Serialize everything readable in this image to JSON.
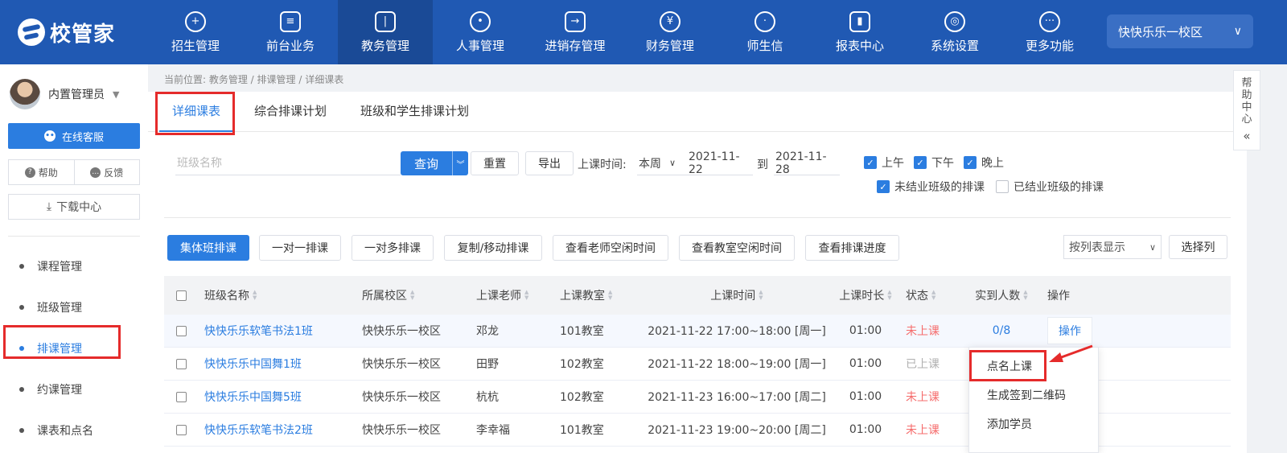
{
  "app": {
    "logo_text": "校管家"
  },
  "nav": {
    "items": [
      {
        "label": "招生管理",
        "icon": "person-add-icon"
      },
      {
        "label": "前台业务",
        "icon": "monitor-icon"
      },
      {
        "label": "教务管理",
        "icon": "book-icon"
      },
      {
        "label": "人事管理",
        "icon": "person-icon"
      },
      {
        "label": "进销存管理",
        "icon": "login-box-icon"
      },
      {
        "label": "财务管理",
        "icon": "money-bag-icon"
      },
      {
        "label": "师生信",
        "icon": "chat-icon"
      },
      {
        "label": "报表中心",
        "icon": "bar-chart-icon"
      },
      {
        "label": "系统设置",
        "icon": "settings-icon"
      },
      {
        "label": "更多功能",
        "icon": "more-icon"
      }
    ],
    "active_index": 2,
    "campus": "快快乐乐一校区"
  },
  "sidebar": {
    "user_name": "内置管理员",
    "service_label": "在线客服",
    "help_label": "帮助",
    "feedback_label": "反馈",
    "download_label": "下载中心",
    "menu": [
      {
        "label": "课程管理"
      },
      {
        "label": "班级管理"
      },
      {
        "label": "排课管理"
      },
      {
        "label": "约课管理"
      },
      {
        "label": "课表和点名"
      }
    ],
    "active_index": 2
  },
  "breadcrumb": "当前位置: 教务管理 / 排课管理 / 详细课表",
  "tabs": [
    {
      "label": "详细课表"
    },
    {
      "label": "综合排课计划"
    },
    {
      "label": "班级和学生排课计划"
    }
  ],
  "filters": {
    "class_placeholder": "班级名称",
    "query_label": "查询",
    "reset_label": "重置",
    "export_label": "导出",
    "time_label": "上课时间:",
    "period_value": "本周",
    "date_from": "2021-11-22",
    "date_sep": "到",
    "date_to": "2021-11-28",
    "morning": "上午",
    "afternoon": "下午",
    "evening": "晚上",
    "unfinished_label": "未结业班级的排课",
    "finished_label": "已结业班级的排课"
  },
  "actions": {
    "group": "集体班排课",
    "one_to_one": "一对一排课",
    "one_to_many": "一对多排课",
    "copy_move": "复制/移动排课",
    "teacher_free": "查看老师空闲时间",
    "room_free": "查看教室空闲时间",
    "progress": "查看排课进度",
    "view_mode": "按列表显示",
    "choose_cols": "选择列"
  },
  "table": {
    "headers": [
      "班级名称",
      "所属校区",
      "上课老师",
      "上课教室",
      "上课时间",
      "上课时长",
      "状态",
      "实到人数",
      "操作"
    ],
    "rows": [
      {
        "name": "快快乐乐软笔书法1班",
        "campus": "快快乐乐一校区",
        "teacher": "邓龙",
        "room": "101教室",
        "time": "2021-11-22 17:00~18:00 [周一]",
        "duration": "01:00",
        "status": "未上课",
        "attend": "0/8",
        "op": "操作"
      },
      {
        "name": "快快乐乐中国舞1班",
        "campus": "快快乐乐一校区",
        "teacher": "田野",
        "room": "102教室",
        "time": "2021-11-22 18:00~19:00 [周一]",
        "duration": "01:00",
        "status": "已上课",
        "attend": "",
        "op": ""
      },
      {
        "name": "快快乐乐中国舞5班",
        "campus": "快快乐乐一校区",
        "teacher": "杭杭",
        "room": "102教室",
        "time": "2021-11-23 16:00~17:00 [周二]",
        "duration": "01:00",
        "status": "未上课",
        "attend": "",
        "op": ""
      },
      {
        "name": "快快乐乐软笔书法2班",
        "campus": "快快乐乐一校区",
        "teacher": "李幸福",
        "room": "101教室",
        "time": "2021-11-23 19:00~20:00 [周二]",
        "duration": "01:00",
        "status": "未上课",
        "attend": "",
        "op": ""
      }
    ]
  },
  "dropdown": {
    "items": [
      {
        "label": "点名上课"
      },
      {
        "label": "生成签到二维码"
      },
      {
        "label": "添加学员"
      }
    ]
  },
  "help_panel": {
    "label_chars": [
      "帮",
      "助",
      "中",
      "心"
    ],
    "collapse": "«"
  },
  "colors": {
    "primary": "#2b7de0",
    "nav_bg": "#2059b3",
    "annotation_red": "#e52b2b",
    "status_red": "#f56c6c"
  }
}
